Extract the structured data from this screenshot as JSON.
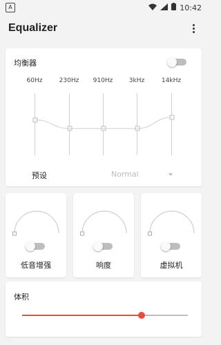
{
  "status": {
    "time": "10:42",
    "app_badge": "A"
  },
  "app": {
    "title": "Equalizer"
  },
  "equalizer": {
    "label": "均衡器",
    "enabled": false,
    "bands": [
      {
        "freq": "60Hz",
        "level": 0.57
      },
      {
        "freq": "230Hz",
        "level": 0.43
      },
      {
        "freq": "910Hz",
        "level": 0.43
      },
      {
        "freq": "3kHz",
        "level": 0.43
      },
      {
        "freq": "14kHz",
        "level": 0.61
      }
    ],
    "preset_label": "预设",
    "preset_value": "Normal"
  },
  "effects": [
    {
      "label": "低音增强",
      "enabled": false
    },
    {
      "label": "响度",
      "enabled": false
    },
    {
      "label": "虚拟机",
      "enabled": false
    }
  ],
  "volume": {
    "label": "体积",
    "level": 0.72,
    "accent": "#e74c3c"
  }
}
